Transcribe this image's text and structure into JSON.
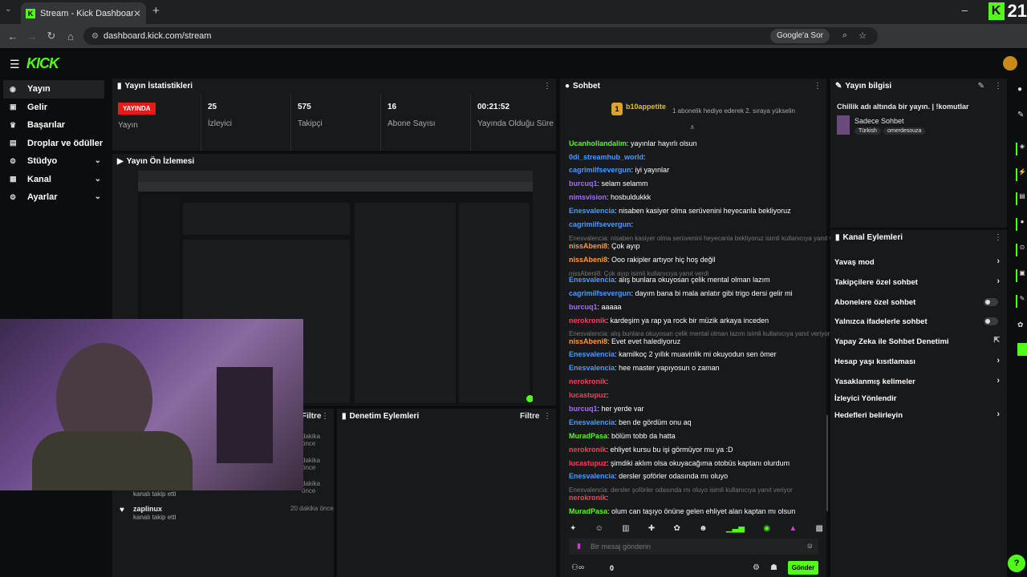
{
  "browser": {
    "tab_title": "Stream - Kick Dashboard",
    "url": "dashboard.kick.com/stream",
    "google_btn": "Google'a Sor",
    "viewer_overlay": "21"
  },
  "sidebar": {
    "items": [
      {
        "label": "Yayın",
        "icon": "broadcast-icon"
      },
      {
        "label": "Gelir",
        "icon": "revenue-icon"
      },
      {
        "label": "Başarılar",
        "icon": "trophy-icon"
      },
      {
        "label": "Droplar ve ödüller",
        "icon": "gift-icon"
      },
      {
        "label": "Stüdyo",
        "icon": "studio-icon"
      },
      {
        "label": "Kanal",
        "icon": "channel-icon"
      },
      {
        "label": "Ayarlar",
        "icon": "gear-icon"
      }
    ]
  },
  "stats": {
    "title": "Yayın İstatistikleri",
    "live_badge": "YAYINDA",
    "live_label": "Yayın",
    "viewers": "25",
    "viewers_label": "İzleyici",
    "followers": "575",
    "followers_label": "Takipçi",
    "subs": "16",
    "subs_label": "Abone Sayısı",
    "duration": "00:21:52",
    "duration_label": "Yayında Olduğu Süre"
  },
  "preview": {
    "title": "Yayın Ön İzlemesi"
  },
  "followers_panel": {
    "filter": "Filtre",
    "times": [
      "dakika önce",
      "dakika önce",
      "dakika önce"
    ],
    "items": [
      {
        "text": "kanalı takip etti"
      },
      {
        "name": "zaplinux",
        "text": "kanalı takip etti",
        "time": "20 dakika önce"
      }
    ]
  },
  "moderation": {
    "title": "Denetim Eylemleri",
    "filter": "Filtre"
  },
  "chat": {
    "title": "Sohbet",
    "pinned_user": "b10appetite",
    "pinned_text": "1 abonelik hediye ederek 2. sıraya yükselin",
    "placeholder": "Bir mesaj gönderin",
    "send": "Gönder",
    "count": "0",
    "messages": [
      {
        "user": "Ucanhollandalim",
        "cls": "u-g",
        "text": "yayınlar hayırlı olsun"
      },
      {
        "user": "0di_streamhub_world",
        "cls": "u-b",
        "text": ""
      },
      {
        "user": "cagrimilfsevergun",
        "cls": "u-b",
        "text": "iyi yayınlar"
      },
      {
        "user": "burcuq1",
        "cls": "u-p",
        "text": "selam selamm"
      },
      {
        "user": "nimsvision",
        "cls": "u-p",
        "text": "hosbuldukkk"
      },
      {
        "user": "Enesvalencia",
        "cls": "u-b",
        "text": "nisaben kasiyer olma serüvenini heyecanla bekliyoruz"
      },
      {
        "user": "cagrimilfsevergun",
        "cls": "u-b",
        "text": ""
      },
      {
        "reply": "Enesvalencia: nisaben kasiyer olma serüvenini heyecanla bekliyoruz isimli kullanıcıya yanıt veriyor"
      },
      {
        "user": "nissAbeni8",
        "cls": "u-o",
        "text": "Çok ayıp"
      },
      {
        "user": "nissAbeni8",
        "cls": "u-o",
        "text": "Ooo rakipler artıyor hiç hoş değil"
      },
      {
        "reply": "nissAbeni8: Çok ayıp isimli kullanıcıya yanıt verdi"
      },
      {
        "user": "Enesvalencia",
        "cls": "u-b",
        "text": "alış bunlara okuyosan çelik mental olman lazım"
      },
      {
        "user": "cagrimilfsevergun",
        "cls": "u-b",
        "text": "dayım bana bi mala anlatır gibi trigo dersi gelir mi"
      },
      {
        "user": "burcuq1",
        "cls": "u-p",
        "text": "aaaaa"
      },
      {
        "user": "nerokronik",
        "cls": "u-r",
        "text": "kardeşim ya rap ya rock bir müzik arkaya inceden"
      },
      {
        "reply": "Enesvalencia: alış bunlara okuyosan çelik mental olman lazım isimli kullanıcıya yanıt veriyor"
      },
      {
        "user": "nissAbeni8",
        "cls": "u-o",
        "text": "Evet evet halediyoruz"
      },
      {
        "user": "Enesvalencia",
        "cls": "u-b",
        "text": "kamilkoç 2 yıllık muavinlik mi okuyodun sen ömer"
      },
      {
        "user": "Enesvalencia",
        "cls": "u-b",
        "text": "hee master yapıyosun o zaman"
      },
      {
        "user": "nerokronik",
        "cls": "u-r",
        "text": ""
      },
      {
        "user": "lucastupuz",
        "cls": "u-r",
        "text": ""
      },
      {
        "user": "burcuq1",
        "cls": "u-p",
        "text": "her yerde var"
      },
      {
        "user": "Enesvalencia",
        "cls": "u-b",
        "text": "ben de gördüm onu aq"
      },
      {
        "user": "MuradPasa",
        "cls": "u-g",
        "text": "bölüm tobb da hatta"
      },
      {
        "user": "nerokronik",
        "cls": "u-r",
        "text": "ehliyet kursu bu işi görmüyor mu ya :D"
      },
      {
        "user": "lucastupuz",
        "cls": "u-r",
        "text": "şimdiki aklım olsa okuyacağıma otobüs kaptanı olurdum"
      },
      {
        "user": "Enesvalencia",
        "cls": "u-b",
        "text": "dersler şoförler odasında mı oluyo"
      },
      {
        "reply": "Enesvalencia: dersler şoförler odasında mı oluyo isimli kullanıcıya yanıt veriyor"
      },
      {
        "user": "nerokronik",
        "cls": "u-r",
        "text": ""
      },
      {
        "user": "MuradPasa",
        "cls": "u-g",
        "text": "olum can taşıyo önüne gelen ehliyet alan kaptan mı olsun"
      }
    ]
  },
  "stream_info": {
    "title": "Yayın bilgisi",
    "stream_title": "Chillik adı altında bir yayın. | !komutlar",
    "category": "Sadece Sohbet",
    "tags": [
      "Türkish",
      "omerdesouza"
    ]
  },
  "channel_actions": {
    "title": "Kanal Eylemleri",
    "items": [
      {
        "label": "Yavaş mod",
        "ctl": "chevron"
      },
      {
        "label": "Takipçilere özel sohbet",
        "ctl": "chevron"
      },
      {
        "label": "Abonelere özel sohbet",
        "ctl": "toggle"
      },
      {
        "label": "Yalnızca ifadelerle sohbet",
        "ctl": "toggle"
      },
      {
        "label": "Yapay Zeka ile Sohbet Denetimi",
        "ctl": "ext"
      },
      {
        "label": "Hesap yaşı kısıtlaması",
        "ctl": "chevron"
      },
      {
        "label": "Yasaklanmış kelimeler",
        "ctl": "chevron"
      },
      {
        "label": "İzleyici Yönlendir",
        "ctl": "none"
      },
      {
        "label": "Hedefleri belirleyin",
        "ctl": "chevron"
      }
    ]
  }
}
